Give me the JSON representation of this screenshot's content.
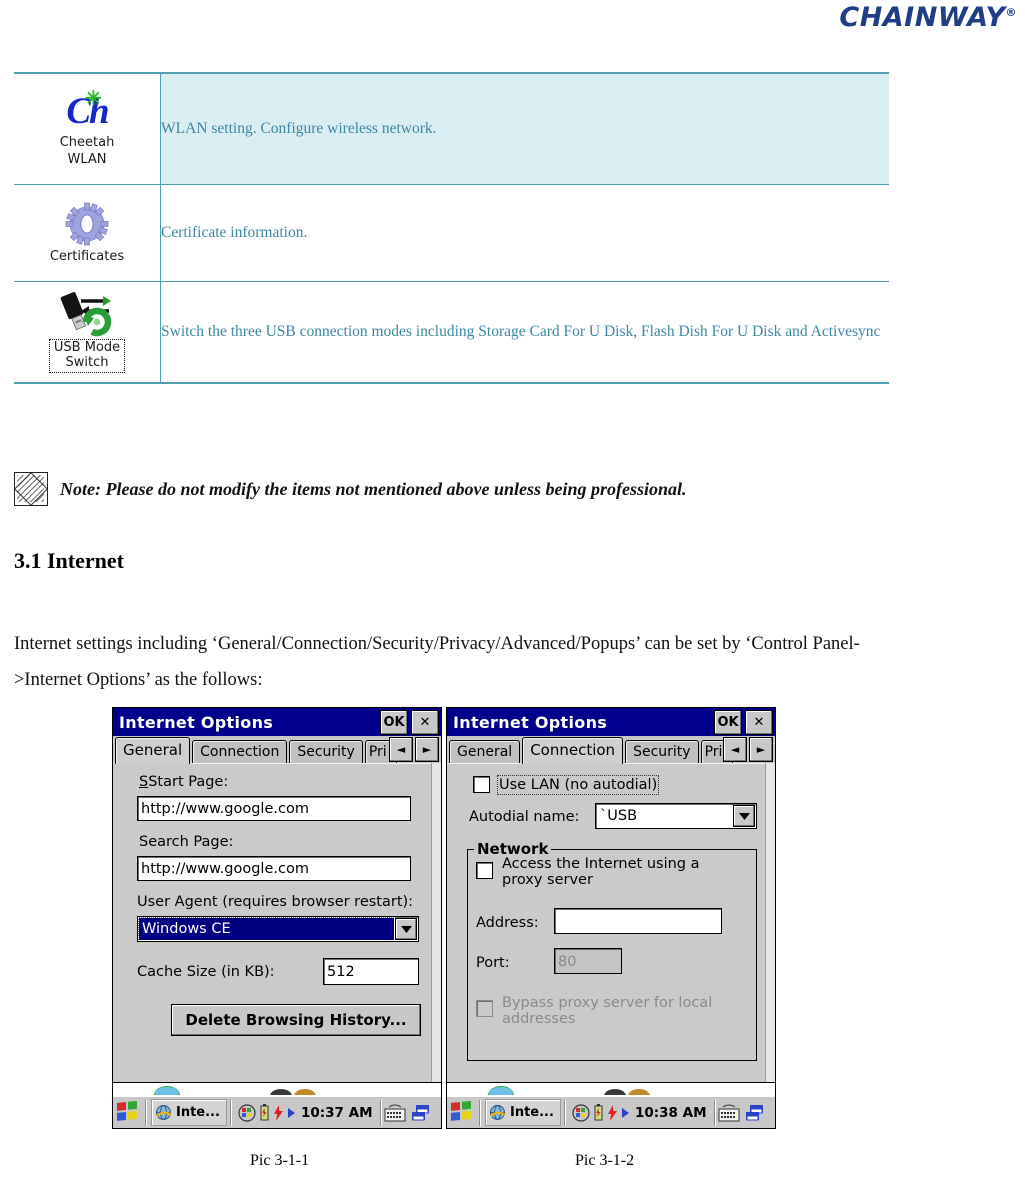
{
  "header": {
    "brand": "CHAINWAY",
    "brand_mark": "®"
  },
  "feature_table": {
    "rows": [
      {
        "icon_name": "cheetah-wlan-icon",
        "icon_label_line1": "Cheetah",
        "icon_label_line2": "WLAN",
        "description": "WLAN setting. Configure wireless network.",
        "highlighted": true
      },
      {
        "icon_name": "certificates-icon",
        "icon_label_line1": "Certificates",
        "icon_label_line2": "",
        "description": "Certificate information.",
        "highlighted": false
      },
      {
        "icon_name": "usb-mode-switch-icon",
        "icon_label_line1": "USB Mode",
        "icon_label_line2": "Switch",
        "description": "Switch the three USB connection modes including Storage Card For U Disk, Flash Dish For U Disk and Activesync",
        "highlighted": false
      }
    ]
  },
  "note": {
    "text": "Note: Please do not modify the items not mentioned above unless being professional."
  },
  "section": {
    "heading": "3.1 Internet",
    "paragraph": "Internet settings including ‘General/Connection/Security/Privacy/Advanced/Popups’ can be set by ‘Control Panel->Internet Options’ as the follows:"
  },
  "screenshots": {
    "left": {
      "caption": "Pic 3-1-1",
      "window": {
        "title": "Internet Options",
        "ok_label": "OK",
        "close_label": "✕",
        "tabs": [
          {
            "label": "General",
            "selected": true
          },
          {
            "label": "Connection",
            "selected": false
          },
          {
            "label": "Security",
            "selected": false
          },
          {
            "label": "Pri",
            "selected": false
          }
        ],
        "scroll_left": "◄",
        "scroll_right": "►",
        "fields": {
          "start_page_label": "Start Page:",
          "start_page_value": "http://www.google.com",
          "search_page_label": "Search Page:",
          "search_page_value": "http://www.google.com",
          "user_agent_label": "User Agent (requires browser restart):",
          "user_agent_value": "Windows CE",
          "cache_size_label": "Cache Size (in KB):",
          "cache_size_value": "512",
          "delete_history_button": "Delete Browsing History..."
        },
        "taskbar": {
          "task_item": "Inte...",
          "clock": "10:37 AM"
        }
      }
    },
    "right": {
      "caption": "Pic 3-1-2",
      "window": {
        "title": "Internet Options",
        "ok_label": "OK",
        "close_label": "✕",
        "tabs": [
          {
            "label": "General",
            "selected": false
          },
          {
            "label": "Connection",
            "selected": true
          },
          {
            "label": "Security",
            "selected": false
          },
          {
            "label": "Pri",
            "selected": false
          }
        ],
        "scroll_left": "◄",
        "scroll_right": "►",
        "fields": {
          "use_lan_label": "Use LAN (no autodial)",
          "use_lan_checked": false,
          "autodial_label": "Autodial name:",
          "autodial_value": "`USB",
          "network_group": "Network",
          "proxy_label_line1": "Access the Internet using a",
          "proxy_label_line2": "proxy server",
          "proxy_checked": false,
          "address_label": "Address:",
          "address_value": "",
          "port_label": "Port:",
          "port_value": "80",
          "bypass_label_line1": "Bypass proxy server for local",
          "bypass_label_line2": "addresses",
          "bypass_checked": false
        },
        "taskbar": {
          "task_item": "Inte...",
          "clock": "10:38 AM"
        }
      }
    }
  },
  "colors": {
    "brand_blue": "#1f3e87",
    "table_border": "#4f9fb0",
    "table_text": "#3d87a2",
    "row_highlight": "#d9eef3",
    "ce_titlebar": "#00008c",
    "ce_face": "#c8c8c8"
  }
}
